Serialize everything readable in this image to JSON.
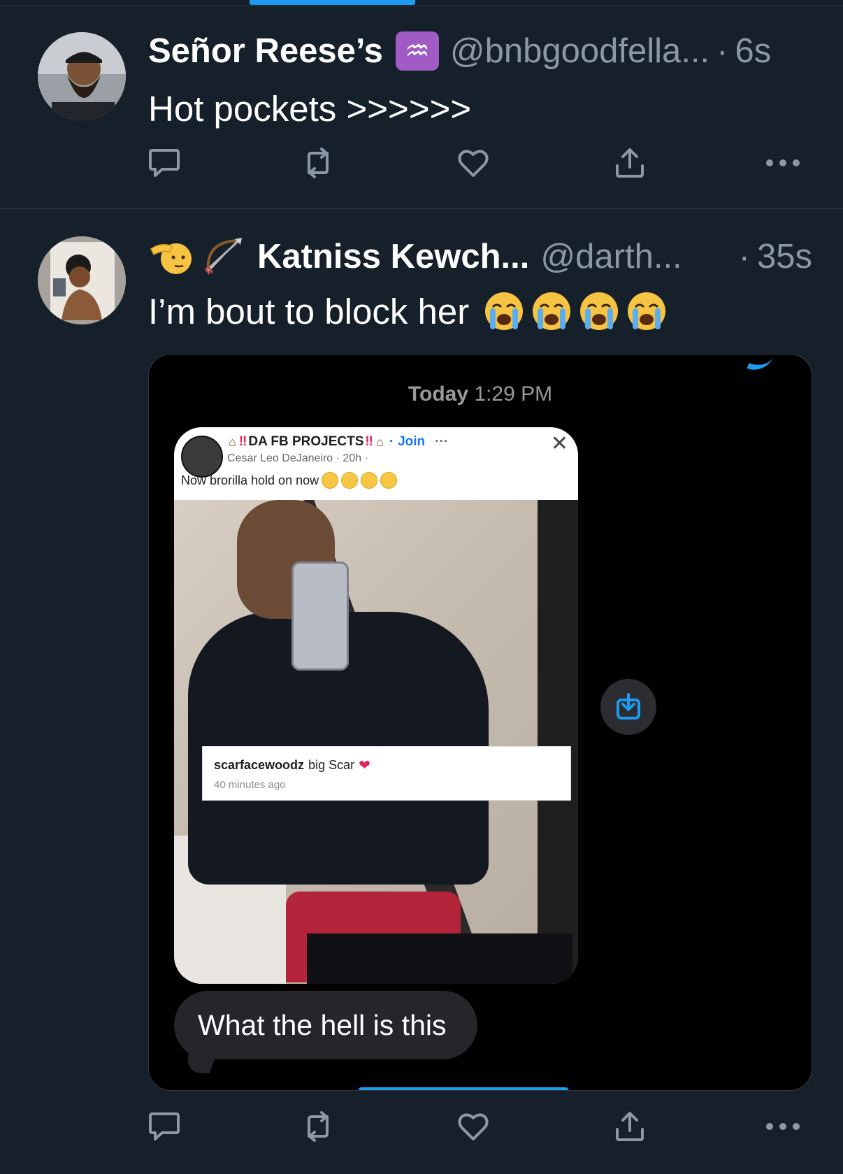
{
  "tweets": [
    {
      "name": "Señor Reese’s",
      "badge": "♒",
      "handle": "@bnbgoodfella...",
      "separator": "·",
      "time": "6s",
      "text": "Hot pockets >>>>>>"
    },
    {
      "name": "Katniss Kewch...",
      "handle": "@darth...",
      "separator": "·",
      "time": "35s",
      "text": "I’m bout to block her"
    }
  ],
  "media": {
    "timestamp_day": "Today",
    "timestamp_time": "1:29 PM",
    "shared_post": {
      "group_name": "DA FB PROJECTS",
      "group_emphasis": "‼",
      "join_sep": "·",
      "join_label": "Join",
      "more": "···",
      "close": "✕",
      "author": "Cesar Leo DeJaneiro",
      "author_meta": "· 20h ·",
      "caption": "Now brorilla hold on now",
      "comment_user": "scarfacewoodz",
      "comment_text": "big Scar",
      "comment_heart": "❤",
      "comment_time": "40 minutes ago"
    },
    "message": "What the hell is this"
  },
  "actions": {
    "more_label": "•••"
  },
  "colors": {
    "background": "#15202b",
    "accent": "#1d9bf0",
    "secondary_text": "#8b98a5",
    "divider": "#2f3b47"
  }
}
